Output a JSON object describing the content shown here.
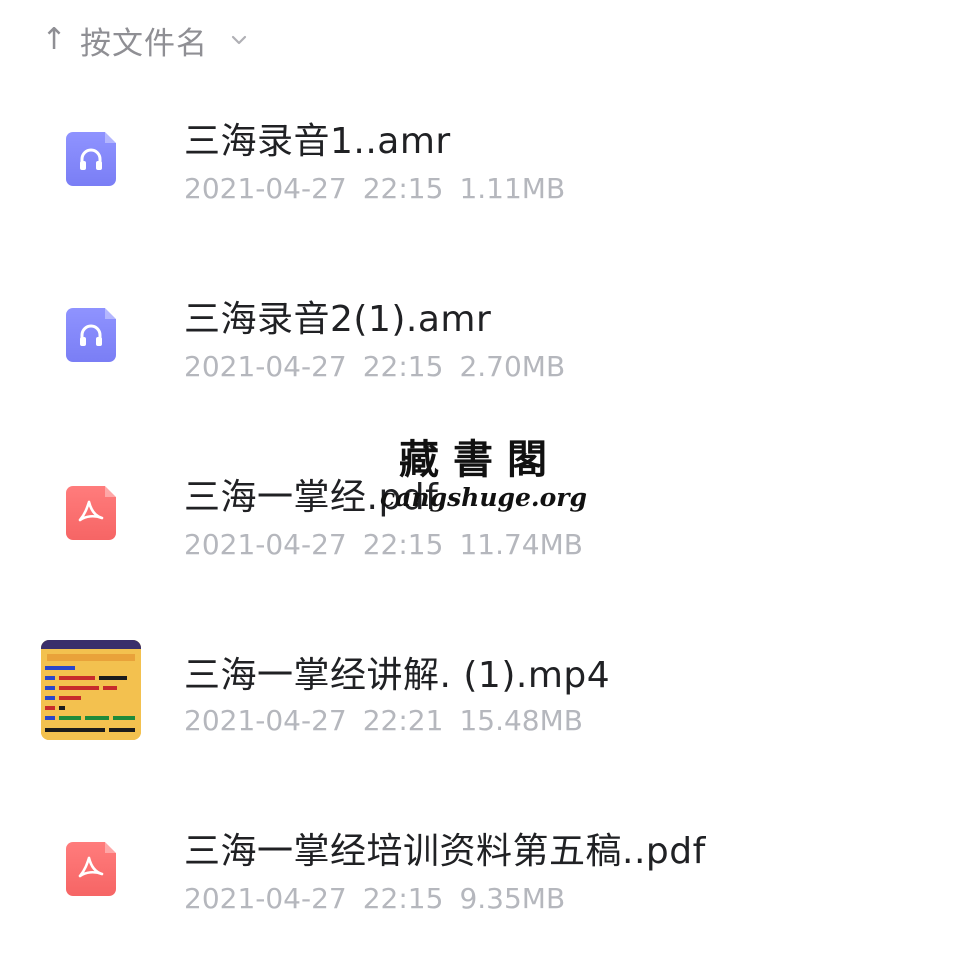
{
  "sort": {
    "arrow": "↑",
    "label": "按文件名",
    "chevron_icon": "chevron-down-icon"
  },
  "files": [
    {
      "name": "三海录音1..amr",
      "date": "2021-04-27",
      "time": "22:15",
      "size": "1.11MB",
      "type": "audio",
      "icon": "headphones-icon"
    },
    {
      "name": "三海录音2(1).amr",
      "date": "2021-04-27",
      "time": "22:15",
      "size": "2.70MB",
      "type": "audio",
      "icon": "headphones-icon"
    },
    {
      "name": "三海一掌经.pdf",
      "date": "2021-04-27",
      "time": "22:15",
      "size": "11.74MB",
      "type": "pdf",
      "icon": "pdf-icon"
    },
    {
      "name": "三海一掌经讲解. (1).mp4",
      "date": "2021-04-27",
      "time": "22:21",
      "size": "15.48MB",
      "type": "video",
      "icon": "video-thumbnail"
    },
    {
      "name": "三海一掌经培训资料第五稿..pdf",
      "date": "2021-04-27",
      "time": "22:15",
      "size": "9.35MB",
      "type": "pdf",
      "icon": "pdf-icon"
    }
  ],
  "watermark": {
    "cn": "藏書閣",
    "en": "cangshuge.org"
  },
  "colors": {
    "audio_icon": "#8a8efc",
    "pdf_icon": "#f86c6c",
    "name_text": "#202124",
    "meta_text": "#b5b7bd",
    "sort_text": "#8f8f94"
  }
}
